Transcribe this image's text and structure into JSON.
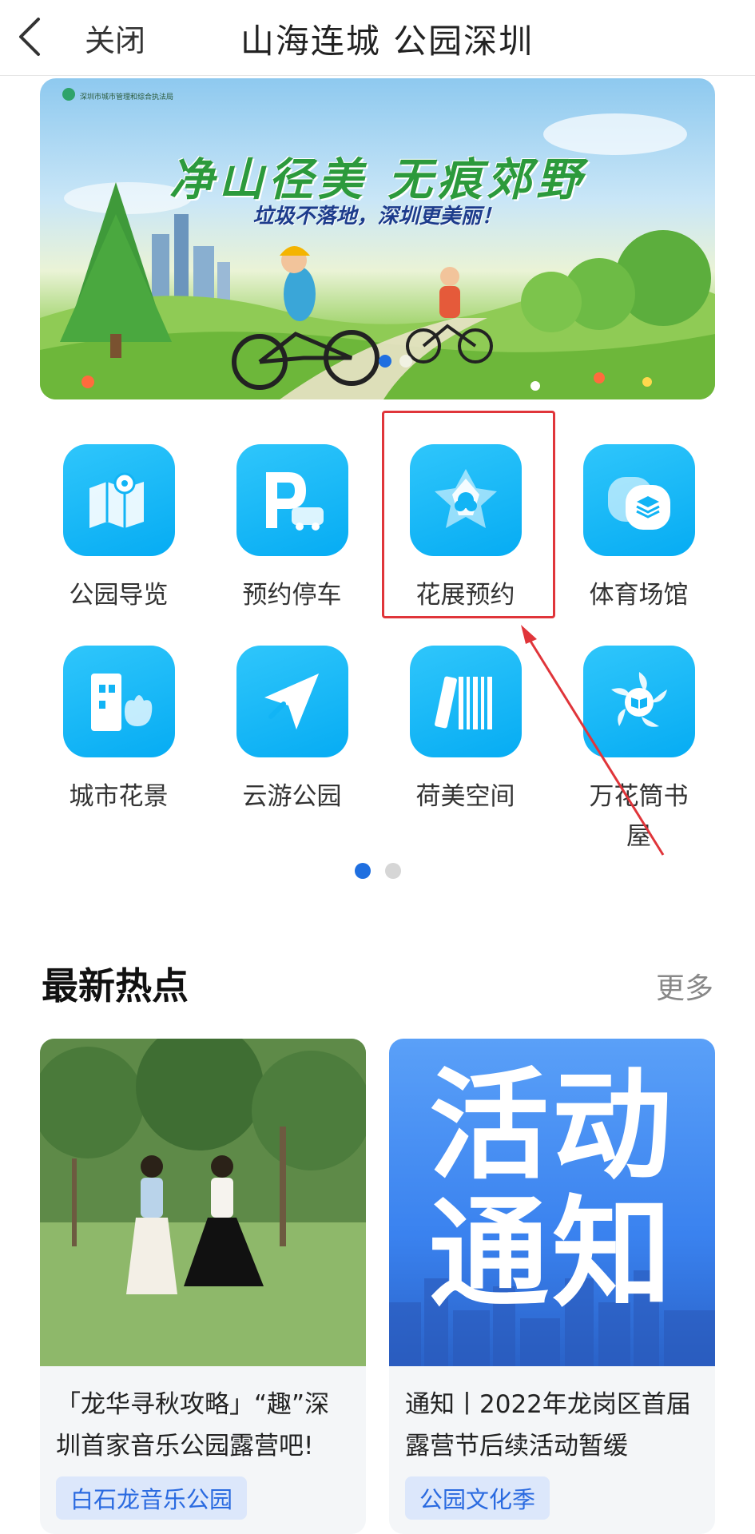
{
  "topbar": {
    "close_label": "关闭",
    "title": "山海连城 公园深圳",
    "back_icon": "chevron-left-icon"
  },
  "banner": {
    "org": "深圳市城市管理和综合执法局",
    "title": "净山径美 无痕郊野",
    "subtitle": "垃圾不落地，深圳更美丽！",
    "page_count": 2,
    "active_page": 1
  },
  "grid": {
    "items": [
      {
        "label": "公园导览",
        "icon": "map-pin-icon"
      },
      {
        "label": "预约停车",
        "icon": "parking-car-icon"
      },
      {
        "label": "花展预约",
        "icon": "flower-petals-icon",
        "highlighted": true
      },
      {
        "label": "体育场馆",
        "icon": "stadium-layers-icon"
      },
      {
        "label": "城市花景",
        "icon": "building-flower-icon"
      },
      {
        "label": "云游公园",
        "icon": "paper-plane-icon"
      },
      {
        "label": "荷美空间",
        "icon": "books-icon"
      },
      {
        "label": "万花筒书屋",
        "icon": "kaleidoscope-book-icon"
      }
    ],
    "page_count": 2,
    "active_page": 1
  },
  "hot": {
    "title": "最新热点",
    "more": "更多",
    "cards": [
      {
        "caption": "「龙华寻秋攻略」“趣”深圳首家音乐公园露营吧!",
        "tag": "白石龙音乐公园"
      },
      {
        "caption": "通知丨2022年龙岗区首届露营节后续活动暂缓",
        "tag": "公园文化季",
        "image_text_line1": "活动",
        "image_text_line2": "通知"
      }
    ]
  },
  "colors": {
    "accent": "#1f6fe0",
    "tile": "#12b4f5",
    "highlight": "#e0353a",
    "tag_bg": "#dce7fb"
  }
}
